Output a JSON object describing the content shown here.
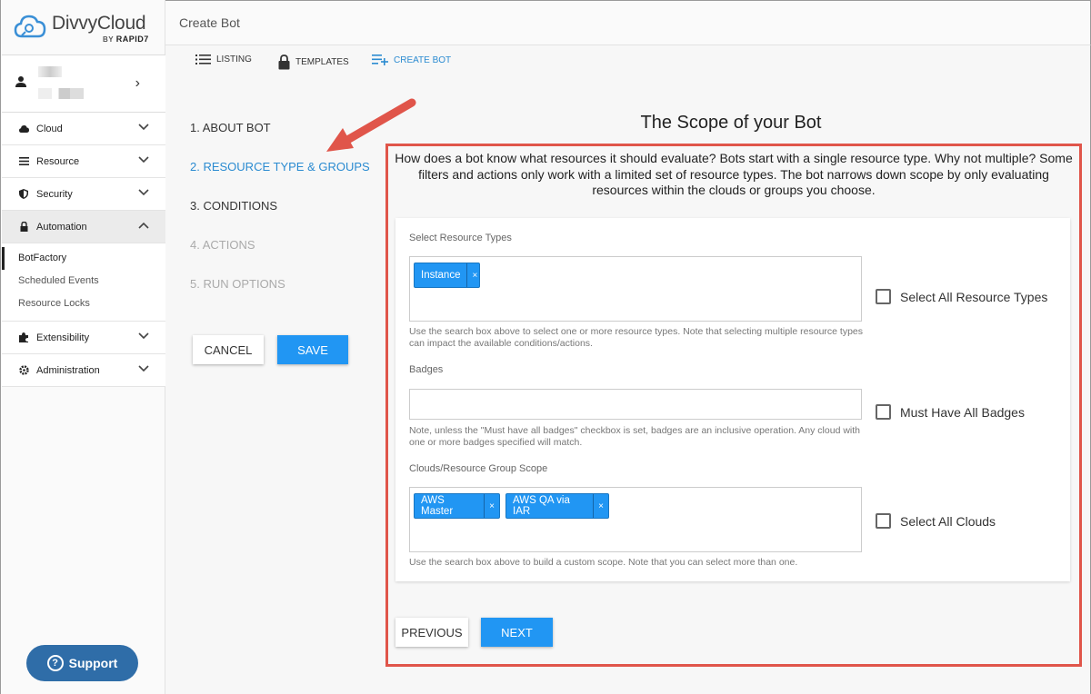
{
  "brand": {
    "name": "DivvyCloud",
    "by": "BY",
    "company": "RAPID7"
  },
  "header": {
    "title": "Create Bot"
  },
  "tabs": [
    {
      "label": "LISTING",
      "icon": "list-icon"
    },
    {
      "label": "TEMPLATES",
      "icon": "lock-icon"
    },
    {
      "label": "CREATE BOT",
      "icon": "playlist-add-icon"
    }
  ],
  "sidebar": {
    "nav": [
      {
        "label": "Cloud",
        "icon": "cloud-icon"
      },
      {
        "label": "Resource",
        "icon": "list-icon"
      },
      {
        "label": "Security",
        "icon": "shield-icon"
      },
      {
        "label": "Automation",
        "icon": "lock-icon"
      },
      {
        "label": "Extensibility",
        "icon": "puzzle-icon"
      },
      {
        "label": "Administration",
        "icon": "gear-icon"
      }
    ],
    "automation_sub": [
      "BotFactory",
      "Scheduled Events",
      "Resource Locks"
    ],
    "support": "Support"
  },
  "steps": [
    "1. ABOUT BOT",
    "2. RESOURCE TYPE & GROUPS",
    "3. CONDITIONS",
    "4. ACTIONS",
    "5. RUN OPTIONS"
  ],
  "buttons": {
    "cancel": "CANCEL",
    "save": "SAVE",
    "previous": "PREVIOUS",
    "next": "NEXT"
  },
  "scope": {
    "title": "The Scope of your Bot",
    "intro": "How does a bot know what resources it should evaluate? Bots start with a single resource type. Why not multiple? Some filters and actions only work with a limited set of resource types. The bot narrows down scope by only evaluating resources within the clouds or groups you choose.",
    "resource_types": {
      "label": "Select Resource Types",
      "chips": [
        "Instance"
      ],
      "help": "Use the search box above to select one or more resource types. Note that selecting multiple resource types can impact the available conditions/actions.",
      "checkbox": "Select All Resource Types"
    },
    "badges": {
      "label": "Badges",
      "help": "Note, unless the \"Must have all badges\" checkbox is set, badges are an inclusive operation. Any cloud with one or more badges specified will match.",
      "checkbox": "Must Have All Badges"
    },
    "clouds": {
      "label": "Clouds/Resource Group Scope",
      "chips": [
        "AWS Master",
        "AWS QA via IAR"
      ],
      "help": "Use the search box above to build a custom scope. Note that you can select more than one.",
      "checkbox": "Select All Clouds"
    }
  },
  "chip_remove": "×",
  "colors": {
    "accent": "#2196f3",
    "highlight": "#e0554a",
    "support": "#2f6da8"
  }
}
